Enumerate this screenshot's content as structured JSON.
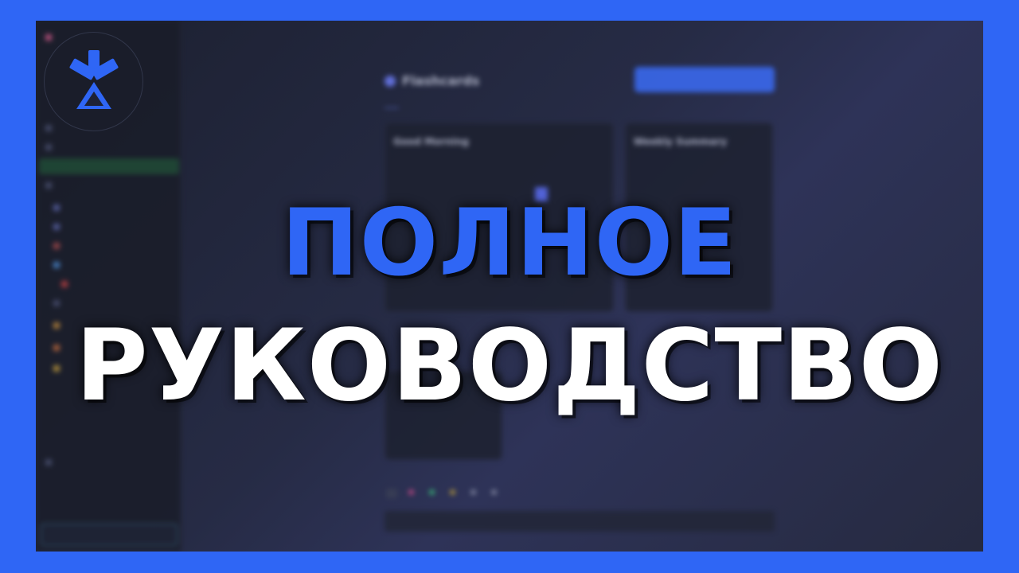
{
  "headline": {
    "line1": "ПОЛНОЕ",
    "line2": "РУКОВОДСТВО"
  },
  "colors": {
    "border_blue": "#2f66f5",
    "headline_blue": "#2f66f5",
    "headline_white": "#ffffff"
  },
  "logo": {
    "icon": "asterisk-triangle-logo-icon"
  },
  "app": {
    "title": "Flashcards",
    "tab_labels": [
      "",
      "",
      "",
      ""
    ]
  },
  "cards": {
    "morning_title": "Good Morning",
    "weekly_title": "Weekly Summary"
  }
}
